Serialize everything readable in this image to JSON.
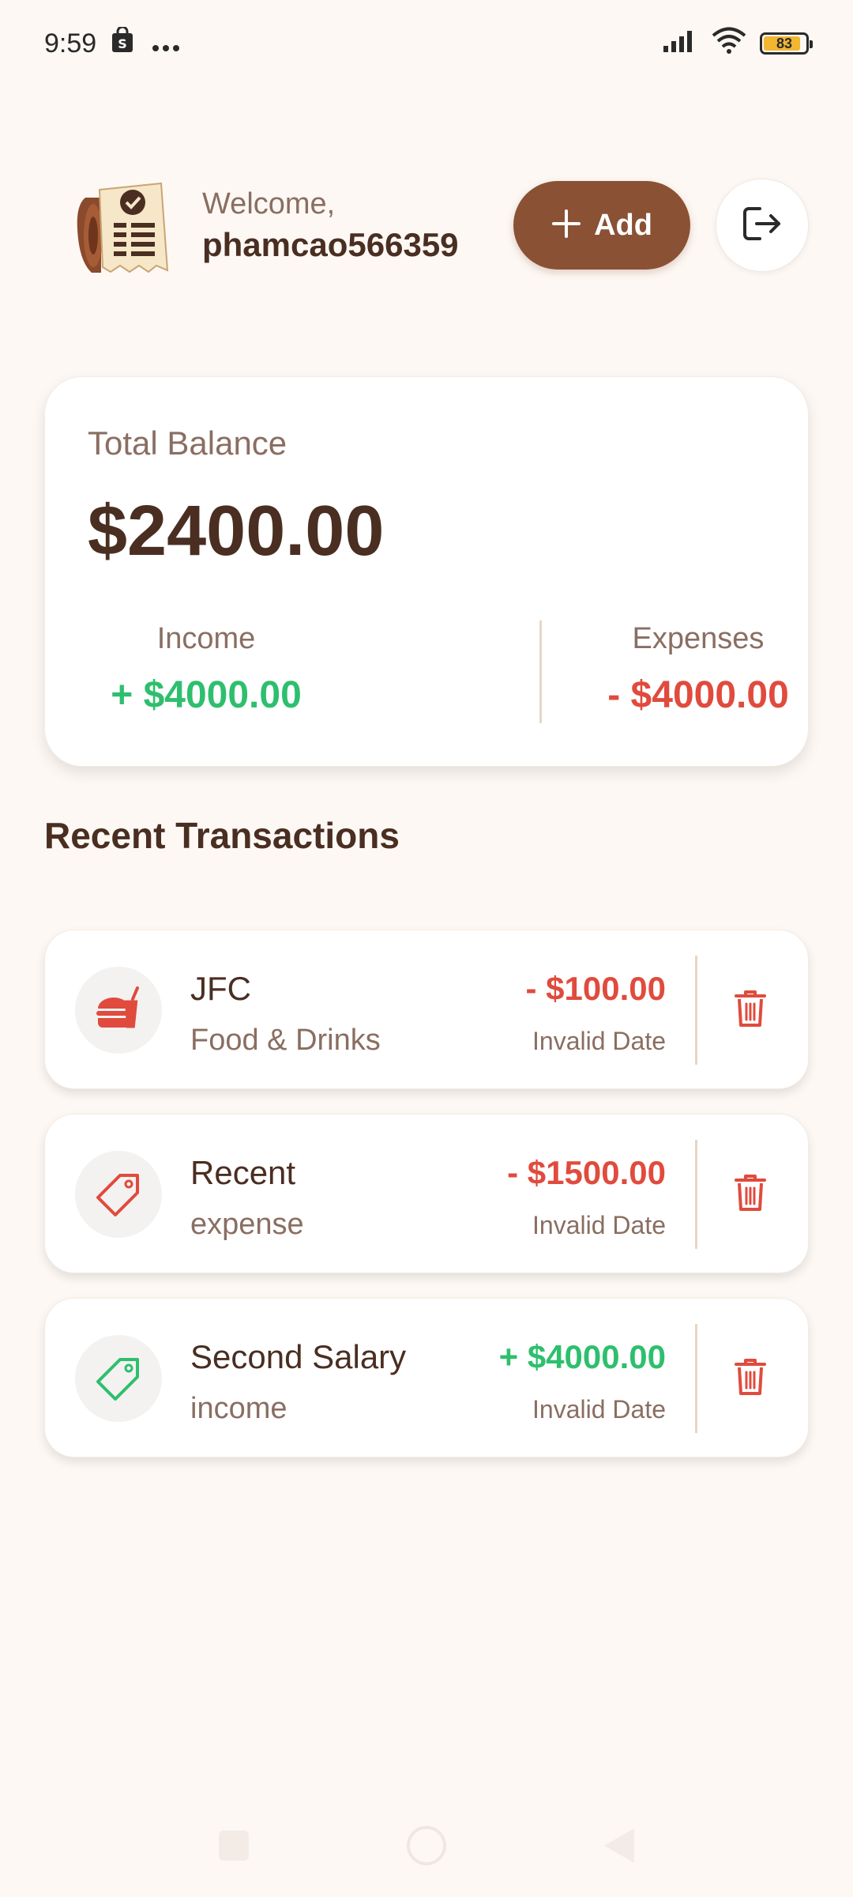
{
  "status_bar": {
    "time": "9:59",
    "left_icons": [
      "shopping-bag-icon",
      "more-icon"
    ],
    "right_icons": [
      "signal-icon",
      "wifi-icon",
      "battery-icon"
    ],
    "battery_level": "83"
  },
  "header": {
    "welcome": "Welcome,",
    "username": "phamcao566359",
    "add_label": "Add",
    "add_icon": "plus-icon",
    "logout_icon": "logout-icon"
  },
  "balance": {
    "label": "Total Balance",
    "amount": "$2400.00",
    "income_label": "Income",
    "income_value": "+ $4000.00",
    "expense_label": "Expenses",
    "expense_value": "- $4000.00"
  },
  "section": {
    "title": "Recent Transactions"
  },
  "transactions": [
    {
      "title": "JFC",
      "category": "Food & Drinks",
      "amount": "- $100.00",
      "date": "Invalid Date",
      "icon": "food-drinks-icon",
      "type": "expense"
    },
    {
      "title": "Recent",
      "category": "expense",
      "amount": "- $1500.00",
      "date": "Invalid Date",
      "icon": "tag-icon",
      "type": "expense"
    },
    {
      "title": "Second Salary",
      "category": "income",
      "amount": "+ $4000.00",
      "date": "Invalid Date",
      "icon": "tag-icon",
      "type": "income"
    }
  ],
  "colors": {
    "background": "#fdf8f4",
    "primary_brown": "#8a5135",
    "text_dark": "#4a2e22",
    "text_muted": "#8a6e62",
    "income_green": "#2ebf6e",
    "expense_red": "#e04b3d",
    "divider": "#e8d5c4"
  }
}
